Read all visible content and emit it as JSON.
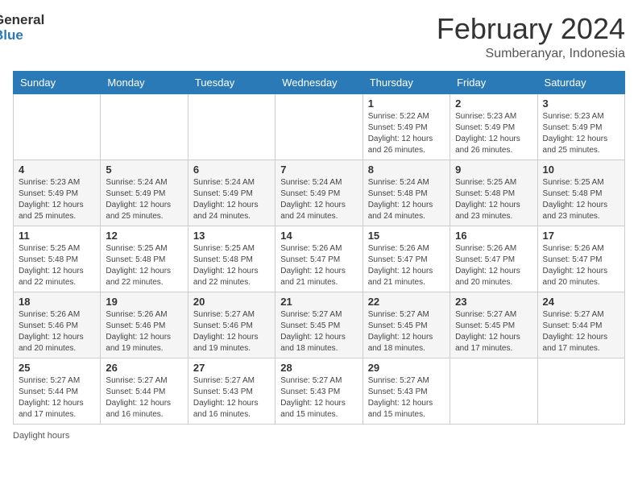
{
  "logo": {
    "general": "General",
    "blue": "Blue"
  },
  "header": {
    "month": "February 2024",
    "location": "Sumberanyar, Indonesia"
  },
  "days_of_week": [
    "Sunday",
    "Monday",
    "Tuesday",
    "Wednesday",
    "Thursday",
    "Friday",
    "Saturday"
  ],
  "weeks": [
    [
      {
        "day": "",
        "info": ""
      },
      {
        "day": "",
        "info": ""
      },
      {
        "day": "",
        "info": ""
      },
      {
        "day": "",
        "info": ""
      },
      {
        "day": "1",
        "info": "Sunrise: 5:22 AM\nSunset: 5:49 PM\nDaylight: 12 hours\nand 26 minutes."
      },
      {
        "day": "2",
        "info": "Sunrise: 5:23 AM\nSunset: 5:49 PM\nDaylight: 12 hours\nand 26 minutes."
      },
      {
        "day": "3",
        "info": "Sunrise: 5:23 AM\nSunset: 5:49 PM\nDaylight: 12 hours\nand 25 minutes."
      }
    ],
    [
      {
        "day": "4",
        "info": "Sunrise: 5:23 AM\nSunset: 5:49 PM\nDaylight: 12 hours\nand 25 minutes."
      },
      {
        "day": "5",
        "info": "Sunrise: 5:24 AM\nSunset: 5:49 PM\nDaylight: 12 hours\nand 25 minutes."
      },
      {
        "day": "6",
        "info": "Sunrise: 5:24 AM\nSunset: 5:49 PM\nDaylight: 12 hours\nand 24 minutes."
      },
      {
        "day": "7",
        "info": "Sunrise: 5:24 AM\nSunset: 5:49 PM\nDaylight: 12 hours\nand 24 minutes."
      },
      {
        "day": "8",
        "info": "Sunrise: 5:24 AM\nSunset: 5:48 PM\nDaylight: 12 hours\nand 24 minutes."
      },
      {
        "day": "9",
        "info": "Sunrise: 5:25 AM\nSunset: 5:48 PM\nDaylight: 12 hours\nand 23 minutes."
      },
      {
        "day": "10",
        "info": "Sunrise: 5:25 AM\nSunset: 5:48 PM\nDaylight: 12 hours\nand 23 minutes."
      }
    ],
    [
      {
        "day": "11",
        "info": "Sunrise: 5:25 AM\nSunset: 5:48 PM\nDaylight: 12 hours\nand 22 minutes."
      },
      {
        "day": "12",
        "info": "Sunrise: 5:25 AM\nSunset: 5:48 PM\nDaylight: 12 hours\nand 22 minutes."
      },
      {
        "day": "13",
        "info": "Sunrise: 5:25 AM\nSunset: 5:48 PM\nDaylight: 12 hours\nand 22 minutes."
      },
      {
        "day": "14",
        "info": "Sunrise: 5:26 AM\nSunset: 5:47 PM\nDaylight: 12 hours\nand 21 minutes."
      },
      {
        "day": "15",
        "info": "Sunrise: 5:26 AM\nSunset: 5:47 PM\nDaylight: 12 hours\nand 21 minutes."
      },
      {
        "day": "16",
        "info": "Sunrise: 5:26 AM\nSunset: 5:47 PM\nDaylight: 12 hours\nand 20 minutes."
      },
      {
        "day": "17",
        "info": "Sunrise: 5:26 AM\nSunset: 5:47 PM\nDaylight: 12 hours\nand 20 minutes."
      }
    ],
    [
      {
        "day": "18",
        "info": "Sunrise: 5:26 AM\nSunset: 5:46 PM\nDaylight: 12 hours\nand 20 minutes."
      },
      {
        "day": "19",
        "info": "Sunrise: 5:26 AM\nSunset: 5:46 PM\nDaylight: 12 hours\nand 19 minutes."
      },
      {
        "day": "20",
        "info": "Sunrise: 5:27 AM\nSunset: 5:46 PM\nDaylight: 12 hours\nand 19 minutes."
      },
      {
        "day": "21",
        "info": "Sunrise: 5:27 AM\nSunset: 5:45 PM\nDaylight: 12 hours\nand 18 minutes."
      },
      {
        "day": "22",
        "info": "Sunrise: 5:27 AM\nSunset: 5:45 PM\nDaylight: 12 hours\nand 18 minutes."
      },
      {
        "day": "23",
        "info": "Sunrise: 5:27 AM\nSunset: 5:45 PM\nDaylight: 12 hours\nand 17 minutes."
      },
      {
        "day": "24",
        "info": "Sunrise: 5:27 AM\nSunset: 5:44 PM\nDaylight: 12 hours\nand 17 minutes."
      }
    ],
    [
      {
        "day": "25",
        "info": "Sunrise: 5:27 AM\nSunset: 5:44 PM\nDaylight: 12 hours\nand 17 minutes."
      },
      {
        "day": "26",
        "info": "Sunrise: 5:27 AM\nSunset: 5:44 PM\nDaylight: 12 hours\nand 16 minutes."
      },
      {
        "day": "27",
        "info": "Sunrise: 5:27 AM\nSunset: 5:43 PM\nDaylight: 12 hours\nand 16 minutes."
      },
      {
        "day": "28",
        "info": "Sunrise: 5:27 AM\nSunset: 5:43 PM\nDaylight: 12 hours\nand 15 minutes."
      },
      {
        "day": "29",
        "info": "Sunrise: 5:27 AM\nSunset: 5:43 PM\nDaylight: 12 hours\nand 15 minutes."
      },
      {
        "day": "",
        "info": ""
      },
      {
        "day": "",
        "info": ""
      }
    ]
  ],
  "footer": {
    "note": "Daylight hours"
  }
}
